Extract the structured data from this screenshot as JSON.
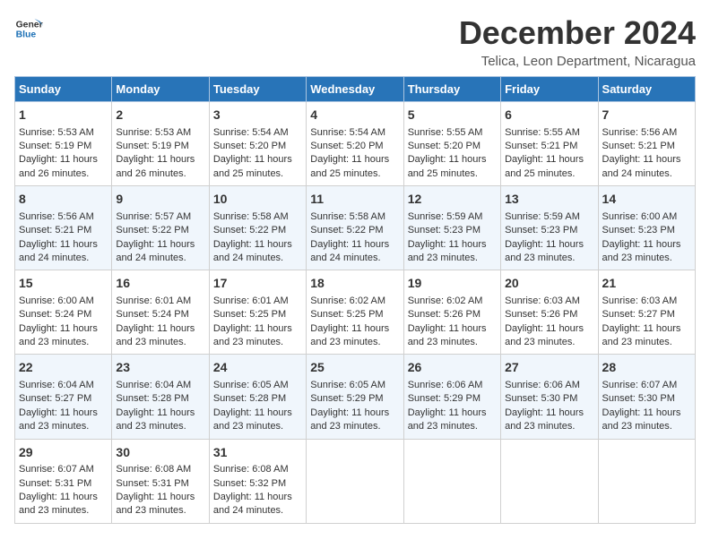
{
  "logo": {
    "line1": "General",
    "line2": "Blue"
  },
  "title": "December 2024",
  "subtitle": "Telica, Leon Department, Nicaragua",
  "headers": [
    "Sunday",
    "Monday",
    "Tuesday",
    "Wednesday",
    "Thursday",
    "Friday",
    "Saturday"
  ],
  "weeks": [
    [
      {
        "day": "1",
        "lines": [
          "Sunrise: 5:53 AM",
          "Sunset: 5:19 PM",
          "Daylight: 11 hours",
          "and 26 minutes."
        ]
      },
      {
        "day": "2",
        "lines": [
          "Sunrise: 5:53 AM",
          "Sunset: 5:19 PM",
          "Daylight: 11 hours",
          "and 26 minutes."
        ]
      },
      {
        "day": "3",
        "lines": [
          "Sunrise: 5:54 AM",
          "Sunset: 5:20 PM",
          "Daylight: 11 hours",
          "and 25 minutes."
        ]
      },
      {
        "day": "4",
        "lines": [
          "Sunrise: 5:54 AM",
          "Sunset: 5:20 PM",
          "Daylight: 11 hours",
          "and 25 minutes."
        ]
      },
      {
        "day": "5",
        "lines": [
          "Sunrise: 5:55 AM",
          "Sunset: 5:20 PM",
          "Daylight: 11 hours",
          "and 25 minutes."
        ]
      },
      {
        "day": "6",
        "lines": [
          "Sunrise: 5:55 AM",
          "Sunset: 5:21 PM",
          "Daylight: 11 hours",
          "and 25 minutes."
        ]
      },
      {
        "day": "7",
        "lines": [
          "Sunrise: 5:56 AM",
          "Sunset: 5:21 PM",
          "Daylight: 11 hours",
          "and 24 minutes."
        ]
      }
    ],
    [
      {
        "day": "8",
        "lines": [
          "Sunrise: 5:56 AM",
          "Sunset: 5:21 PM",
          "Daylight: 11 hours",
          "and 24 minutes."
        ]
      },
      {
        "day": "9",
        "lines": [
          "Sunrise: 5:57 AM",
          "Sunset: 5:22 PM",
          "Daylight: 11 hours",
          "and 24 minutes."
        ]
      },
      {
        "day": "10",
        "lines": [
          "Sunrise: 5:58 AM",
          "Sunset: 5:22 PM",
          "Daylight: 11 hours",
          "and 24 minutes."
        ]
      },
      {
        "day": "11",
        "lines": [
          "Sunrise: 5:58 AM",
          "Sunset: 5:22 PM",
          "Daylight: 11 hours",
          "and 24 minutes."
        ]
      },
      {
        "day": "12",
        "lines": [
          "Sunrise: 5:59 AM",
          "Sunset: 5:23 PM",
          "Daylight: 11 hours",
          "and 23 minutes."
        ]
      },
      {
        "day": "13",
        "lines": [
          "Sunrise: 5:59 AM",
          "Sunset: 5:23 PM",
          "Daylight: 11 hours",
          "and 23 minutes."
        ]
      },
      {
        "day": "14",
        "lines": [
          "Sunrise: 6:00 AM",
          "Sunset: 5:23 PM",
          "Daylight: 11 hours",
          "and 23 minutes."
        ]
      }
    ],
    [
      {
        "day": "15",
        "lines": [
          "Sunrise: 6:00 AM",
          "Sunset: 5:24 PM",
          "Daylight: 11 hours",
          "and 23 minutes."
        ]
      },
      {
        "day": "16",
        "lines": [
          "Sunrise: 6:01 AM",
          "Sunset: 5:24 PM",
          "Daylight: 11 hours",
          "and 23 minutes."
        ]
      },
      {
        "day": "17",
        "lines": [
          "Sunrise: 6:01 AM",
          "Sunset: 5:25 PM",
          "Daylight: 11 hours",
          "and 23 minutes."
        ]
      },
      {
        "day": "18",
        "lines": [
          "Sunrise: 6:02 AM",
          "Sunset: 5:25 PM",
          "Daylight: 11 hours",
          "and 23 minutes."
        ]
      },
      {
        "day": "19",
        "lines": [
          "Sunrise: 6:02 AM",
          "Sunset: 5:26 PM",
          "Daylight: 11 hours",
          "and 23 minutes."
        ]
      },
      {
        "day": "20",
        "lines": [
          "Sunrise: 6:03 AM",
          "Sunset: 5:26 PM",
          "Daylight: 11 hours",
          "and 23 minutes."
        ]
      },
      {
        "day": "21",
        "lines": [
          "Sunrise: 6:03 AM",
          "Sunset: 5:27 PM",
          "Daylight: 11 hours",
          "and 23 minutes."
        ]
      }
    ],
    [
      {
        "day": "22",
        "lines": [
          "Sunrise: 6:04 AM",
          "Sunset: 5:27 PM",
          "Daylight: 11 hours",
          "and 23 minutes."
        ]
      },
      {
        "day": "23",
        "lines": [
          "Sunrise: 6:04 AM",
          "Sunset: 5:28 PM",
          "Daylight: 11 hours",
          "and 23 minutes."
        ]
      },
      {
        "day": "24",
        "lines": [
          "Sunrise: 6:05 AM",
          "Sunset: 5:28 PM",
          "Daylight: 11 hours",
          "and 23 minutes."
        ]
      },
      {
        "day": "25",
        "lines": [
          "Sunrise: 6:05 AM",
          "Sunset: 5:29 PM",
          "Daylight: 11 hours",
          "and 23 minutes."
        ]
      },
      {
        "day": "26",
        "lines": [
          "Sunrise: 6:06 AM",
          "Sunset: 5:29 PM",
          "Daylight: 11 hours",
          "and 23 minutes."
        ]
      },
      {
        "day": "27",
        "lines": [
          "Sunrise: 6:06 AM",
          "Sunset: 5:30 PM",
          "Daylight: 11 hours",
          "and 23 minutes."
        ]
      },
      {
        "day": "28",
        "lines": [
          "Sunrise: 6:07 AM",
          "Sunset: 5:30 PM",
          "Daylight: 11 hours",
          "and 23 minutes."
        ]
      }
    ],
    [
      {
        "day": "29",
        "lines": [
          "Sunrise: 6:07 AM",
          "Sunset: 5:31 PM",
          "Daylight: 11 hours",
          "and 23 minutes."
        ]
      },
      {
        "day": "30",
        "lines": [
          "Sunrise: 6:08 AM",
          "Sunset: 5:31 PM",
          "Daylight: 11 hours",
          "and 23 minutes."
        ]
      },
      {
        "day": "31",
        "lines": [
          "Sunrise: 6:08 AM",
          "Sunset: 5:32 PM",
          "Daylight: 11 hours",
          "and 24 minutes."
        ]
      },
      null,
      null,
      null,
      null
    ]
  ]
}
